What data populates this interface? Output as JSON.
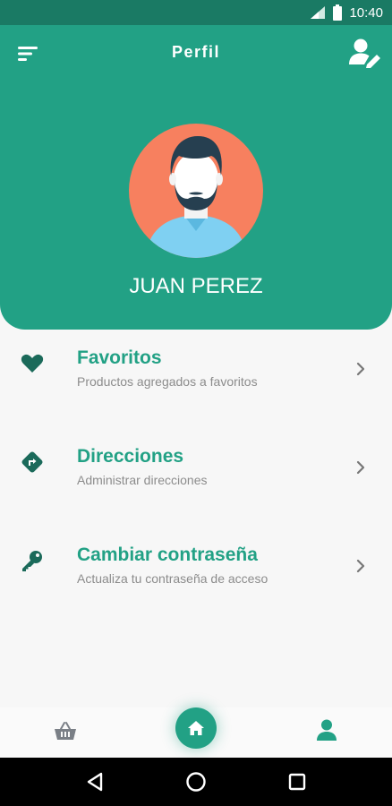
{
  "status_bar": {
    "time": "10:40",
    "icons": [
      "signal-icon",
      "battery-icon"
    ]
  },
  "header": {
    "title": "Perfil",
    "menu_icon": "sort-menu-icon",
    "edit_icon": "user-edit-icon",
    "user_name": "JUAN PEREZ"
  },
  "menu": {
    "items": [
      {
        "icon": "heart-icon",
        "title": "Favoritos",
        "subtitle": "Productos agregados a favoritos"
      },
      {
        "icon": "directions-icon",
        "title": "Direcciones",
        "subtitle": "Administrar direcciones"
      },
      {
        "icon": "key-icon",
        "title": "Cambiar contraseña",
        "subtitle": "Actualiza tu contraseña de acceso"
      }
    ]
  },
  "bottom_nav": {
    "items": [
      "basket-icon",
      "home-icon",
      "profile-icon"
    ],
    "active": "profile-icon"
  },
  "colors": {
    "primary": "#22a185",
    "status_bar": "#1a7a64",
    "avatar_bg": "#f7805f",
    "subtitle": "#8c8c8c",
    "background": "#f7f7f7"
  }
}
